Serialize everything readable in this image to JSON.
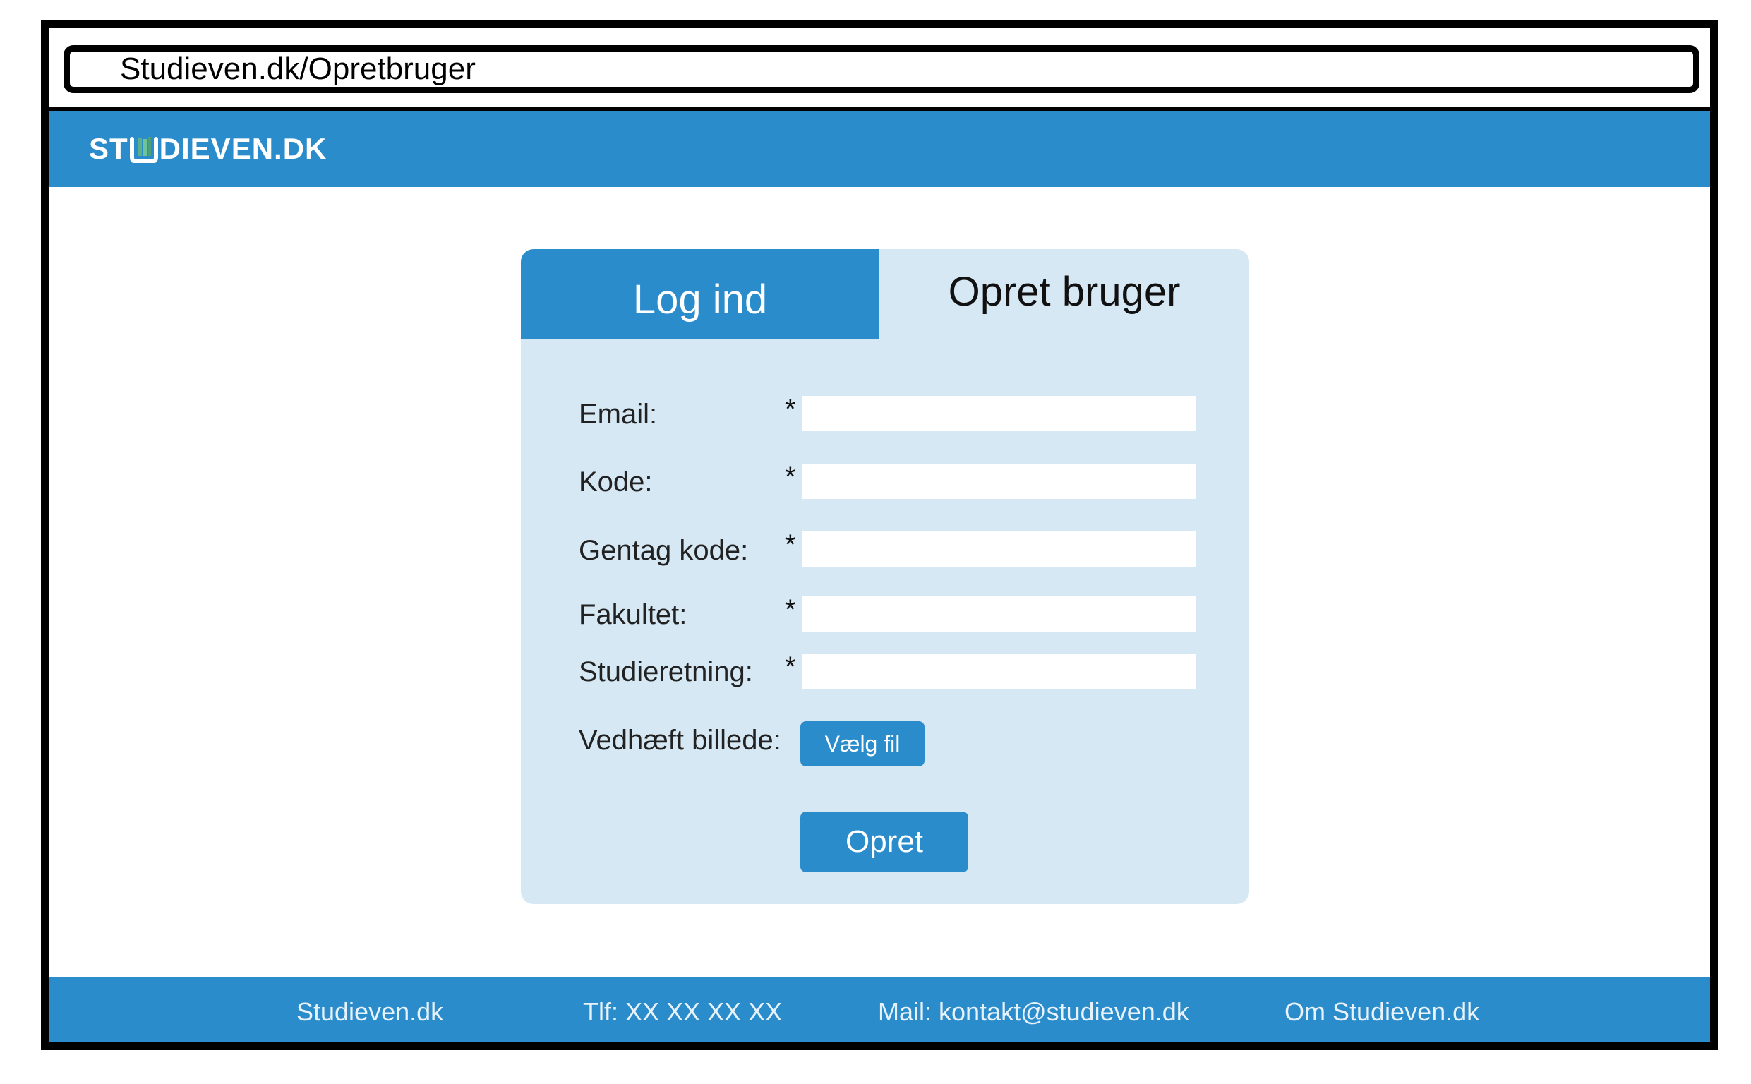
{
  "browser": {
    "url": "Studieven.dk/Opretbruger"
  },
  "header": {
    "logo_left": "ST",
    "logo_right": "DIEVEN.DK",
    "logo_icon": "book-icon"
  },
  "tabs": {
    "login_label": "Log ind",
    "create_label": "Opret bruger"
  },
  "form": {
    "required_marker": "*",
    "fields": [
      {
        "label": "Email:",
        "value": ""
      },
      {
        "label": "Kode:",
        "value": ""
      },
      {
        "label": "Gentag kode:",
        "value": ""
      },
      {
        "label": "Fakultet:",
        "value": ""
      },
      {
        "label": "Studieretning:",
        "value": ""
      }
    ],
    "attach_label": "Vedhæft billede:",
    "file_button_label": "Vælg fil",
    "submit_label": "Opret"
  },
  "footer": {
    "items": [
      "Studieven.dk",
      "Tlf: XX XX XX XX",
      "Mail: kontakt@studieven.dk",
      "Om Studieven.dk"
    ]
  },
  "colors": {
    "accent": "#2b8ccc",
    "card_background": "#d5e8f4",
    "logo_book": "#5bb08a"
  }
}
